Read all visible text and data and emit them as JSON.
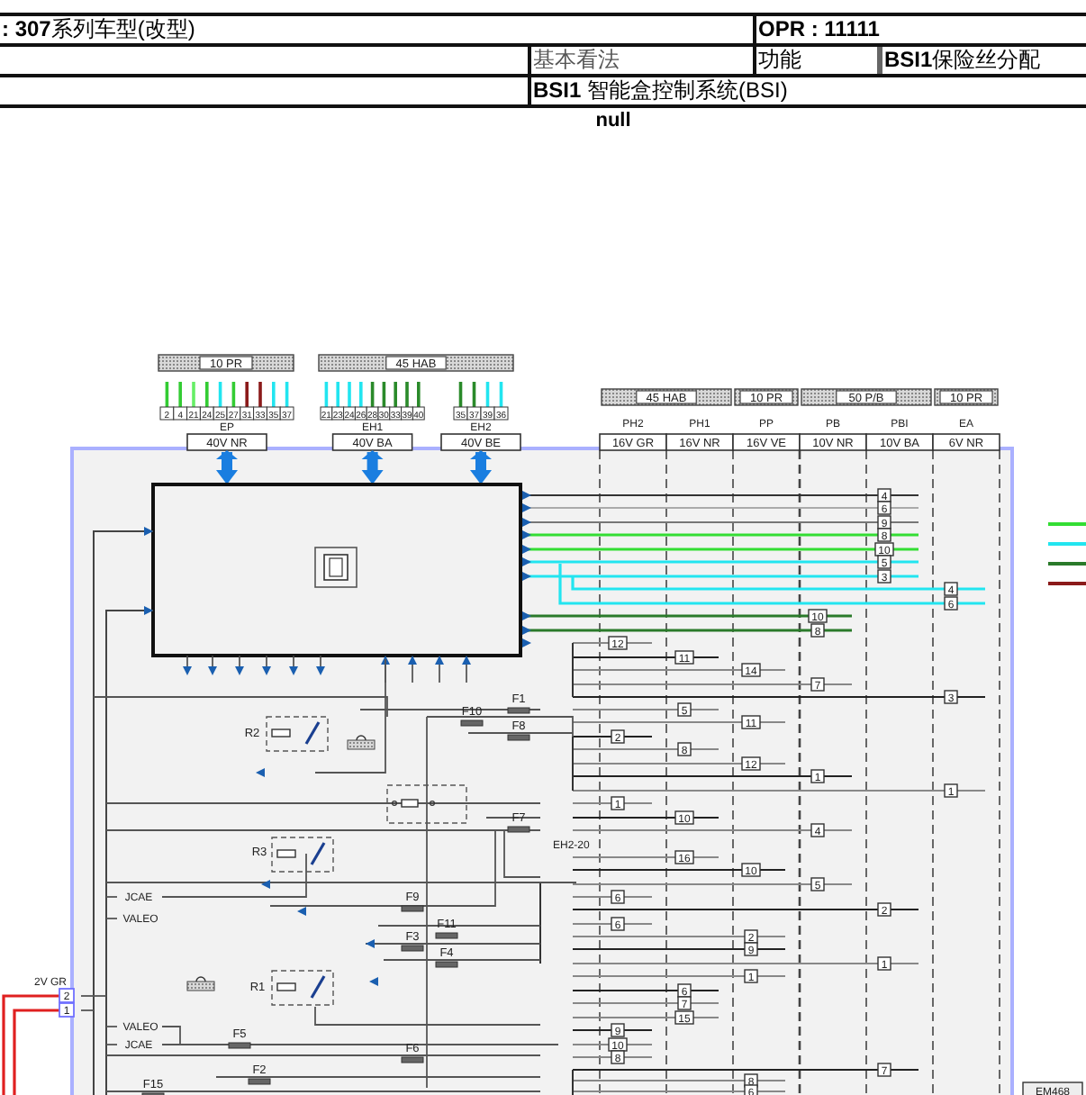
{
  "header": {
    "title": "**: 307**系列车型(改型)",
    "opr": "OPR : 11111",
    "view": "基本看法",
    "function_label": "功能",
    "function": "**BSI1**保险丝分配",
    "system": "**BSI1** 智能盒控制系统(BSI)"
  },
  "subtitle": "null",
  "diagram": {
    "connector_groups": [
      {
        "header": "10 PR",
        "connectors": [
          {
            "name": "EP",
            "voltage": "40V NR",
            "pins": [
              {
                "text": "2",
                "color": "#33cc33"
              },
              {
                "text": "4",
                "color": "#33cc33"
              },
              {
                "text": "21",
                "color": "#66ee66"
              },
              {
                "text": "24",
                "color": "#33cc33"
              },
              {
                "text": "25",
                "color": "#22e5f0"
              },
              {
                "text": "27",
                "color": "#33cc33"
              },
              {
                "text": "31",
                "color": "#8b1a1a"
              },
              {
                "text": "33",
                "color": "#8b1a1a"
              },
              {
                "text": "35",
                "color": "#22e5f0"
              },
              {
                "text": "37",
                "color": "#22e5f0"
              }
            ]
          }
        ]
      },
      {
        "header": "45 HAB",
        "connectors": [
          {
            "name": "EH1",
            "voltage": "40V BA",
            "pins": [
              {
                "text": "21",
                "color": "#22e5f0"
              },
              {
                "text": "23",
                "color": "#22e5f0"
              },
              {
                "text": "24",
                "color": "#22e5f0"
              },
              {
                "text": "26",
                "color": "#22e5f0"
              },
              {
                "text": "28",
                "color": "#2a8a2a"
              },
              {
                "text": "30",
                "color": "#2a8a2a"
              },
              {
                "text": "33",
                "color": "#2a8a2a"
              },
              {
                "text": "39",
                "color": "#2a8a2a"
              },
              {
                "text": "40",
                "color": "#2a8a2a"
              }
            ]
          },
          {
            "name": "EH2",
            "voltage": "40V BE",
            "pins": [
              {
                "text": "35",
                "color": "#2a8a2a"
              },
              {
                "text": "37",
                "color": "#2a8a2a"
              },
              {
                "text": "39",
                "color": "#22e5f0"
              },
              {
                "text": "36",
                "color": "#22e5f0"
              }
            ]
          }
        ]
      }
    ],
    "fuse_groups": [
      {
        "header": "45 HAB",
        "columns": [
          {
            "name": "PH2",
            "voltage": "16V GR"
          },
          {
            "name": "PH1",
            "voltage": "16V NR"
          }
        ]
      },
      {
        "header": "10 PR",
        "columns": [
          {
            "name": "PP",
            "voltage": "16V VE"
          }
        ]
      },
      {
        "header": "50 P/B",
        "columns": [
          {
            "name": "PB",
            "voltage": "10V NR"
          },
          {
            "name": "PBI",
            "voltage": "10V BA"
          }
        ]
      },
      {
        "header": "10 PR",
        "columns": [
          {
            "name": "EA",
            "voltage": "6V NR"
          }
        ]
      }
    ],
    "pin_tags": [
      "4",
      "6",
      "9",
      "8",
      "10",
      "5",
      "3",
      "4",
      "6",
      "10",
      "8",
      "12",
      "11",
      "14",
      "7",
      "3",
      "5",
      "11",
      "2",
      "8",
      "12",
      "1",
      "1",
      "1",
      "10",
      "4",
      "16",
      "10",
      "5",
      "6",
      "2",
      "6",
      "2",
      "9",
      "1",
      "1",
      "6",
      "7",
      "15",
      "9",
      "10",
      "8",
      "7",
      "8",
      "6"
    ],
    "relays": [
      "R2",
      "R3",
      "R1"
    ],
    "fuses": [
      "F1",
      "F10",
      "F8",
      "F7",
      "F9",
      "F11",
      "F3",
      "F4",
      "F5",
      "F6",
      "F2",
      "F15"
    ],
    "signals": [
      "EH2-20",
      "JCAE",
      "VALEO",
      "VALEO",
      "JCAE"
    ],
    "input_connector": {
      "voltage": "2V GR",
      "pins": [
        "2",
        "1"
      ]
    },
    "external_tag": "EM468"
  }
}
